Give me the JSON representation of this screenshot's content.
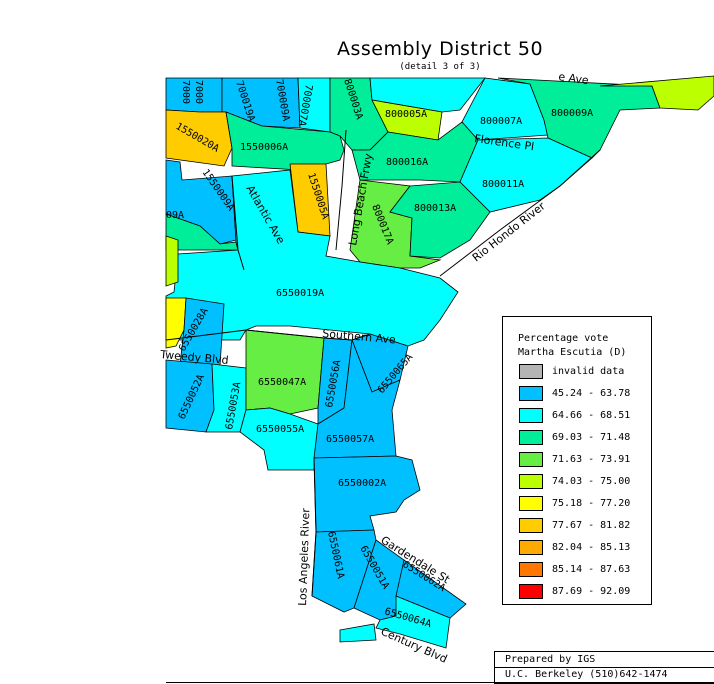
{
  "map": {
    "title": "Assembly District 50",
    "subtitle": "(detail 3 of 3)"
  },
  "legend": {
    "title_line1": "Percentage vote",
    "title_line2": "Martha Escutia (D)",
    "items": [
      {
        "label": "invalid data",
        "color": "#b4b4b4"
      },
      {
        "label": "45.24 - 63.78",
        "color": "#00c0ff"
      },
      {
        "label": "64.66 - 68.51",
        "color": "#00ffff"
      },
      {
        "label": "69.03 - 71.48",
        "color": "#00ee99"
      },
      {
        "label": "71.63 - 73.91",
        "color": "#66ee44"
      },
      {
        "label": "74.03 - 75.00",
        "color": "#bbff00"
      },
      {
        "label": "75.18 - 77.20",
        "color": "#ffff00"
      },
      {
        "label": "77.67 - 81.82",
        "color": "#ffcc00"
      },
      {
        "label": "82.04 - 85.13",
        "color": "#ffaa00"
      },
      {
        "label": "85.14 - 87.63",
        "color": "#ff7700"
      },
      {
        "label": "87.69 - 92.09",
        "color": "#ff0000"
      }
    ]
  },
  "precinct_labels": {
    "p7000": "7000",
    "p700019A": "700019A",
    "p700009A": "700009A",
    "p700007A": "700007A",
    "p800003A": "800003A",
    "p800005A": "800005A",
    "p800007A": "800007A",
    "p800009A": "800009A",
    "p1550020A": "1550020A",
    "p1550006A": "1550006A",
    "p800016A": "800016A",
    "p800011A": "800011A",
    "p1550009A": "1550009A",
    "p1550005A": "1550005A",
    "p800013A": "800013A",
    "p800017A": "800017A",
    "p09A": "09A",
    "p6550019A": "6550019A",
    "p6550028A": "6550028A",
    "p6550052A": "6550052A",
    "p6550053A": "6550053A",
    "p6550047A": "6550047A",
    "p6550056A": "6550056A",
    "p6550065A": "6550065A",
    "p6550055A": "6550055A",
    "p6550057A": "6550057A",
    "p6550002A": "6550002A",
    "p6550061A": "6550061A",
    "p6550051A": "6550051A",
    "p6550062A": "6550062A",
    "p6550064A": "6550064A"
  },
  "street_labels": {
    "ave_top": "e Ave",
    "florence": "Florence Pl",
    "long_beach": "Long Beach Frwy",
    "atlantic": "Atlantic Ave",
    "rio_hondo": "Rio Hondo River",
    "southern": "Southern Ave",
    "tweedy": "Tweedy Blvd",
    "la_river": "Los Angeles River",
    "gardendale": "Gardendale St",
    "century": "Century Blvd"
  },
  "credit": {
    "line1": "Prepared by IGS",
    "line2": "U.C. Berkeley (510)642-1474"
  }
}
